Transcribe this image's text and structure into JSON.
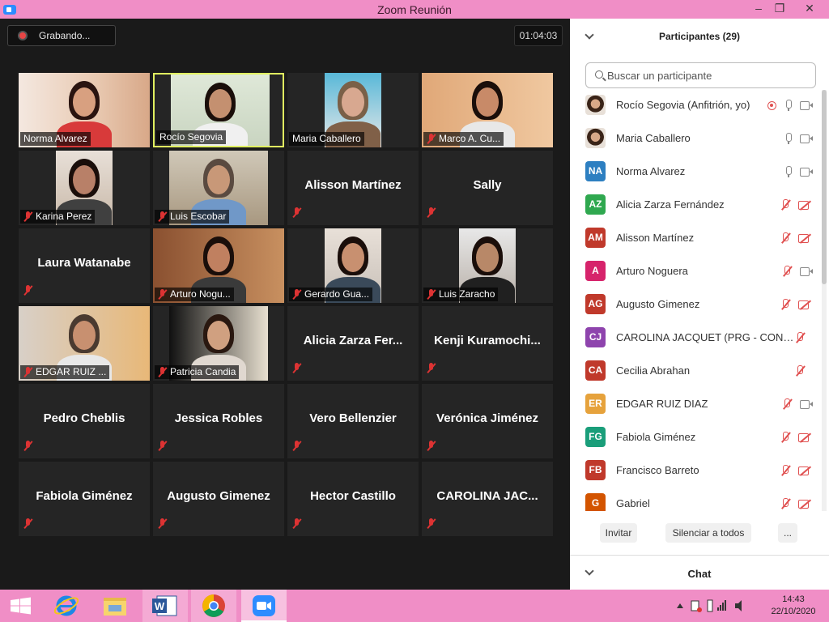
{
  "window": {
    "title": "Zoom Reunión"
  },
  "meeting": {
    "recording_label": "Grabando...",
    "timer": "01:04:03"
  },
  "tiles": [
    {
      "name": "Norma Alvarez",
      "video": true,
      "muted": false
    },
    {
      "name": "Rocío Segovia",
      "video": true,
      "muted": false
    },
    {
      "name": "Maria Caballero",
      "video": true,
      "muted": false
    },
    {
      "name": "Marco A. Cu...",
      "video": true,
      "muted": true
    },
    {
      "name": "Karina Perez",
      "video": true,
      "muted": true
    },
    {
      "name": "Luis Escobar",
      "video": true,
      "muted": true
    },
    {
      "name": "Alisson Martínez",
      "video": false,
      "muted": true
    },
    {
      "name": "Sally",
      "video": false,
      "muted": true
    },
    {
      "name": "Laura Watanabe",
      "video": false,
      "muted": true
    },
    {
      "name": "Arturo Nogu...",
      "video": true,
      "muted": true
    },
    {
      "name": "Gerardo Gua...",
      "video": true,
      "muted": true
    },
    {
      "name": "Luis Zaracho",
      "video": true,
      "muted": true
    },
    {
      "name": "EDGAR RUIZ ...",
      "video": true,
      "muted": true
    },
    {
      "name": "Patricia Candia",
      "video": true,
      "muted": true
    },
    {
      "name": "Alicia Zarza Fer...",
      "video": false,
      "muted": true
    },
    {
      "name": "Kenji Kuramochi...",
      "video": false,
      "muted": true
    },
    {
      "name": "Pedro Cheblis",
      "video": false,
      "muted": true
    },
    {
      "name": "Jessica Robles",
      "video": false,
      "muted": true
    },
    {
      "name": "Vero Bellenzier",
      "video": false,
      "muted": true
    },
    {
      "name": "Verónica Jiménez",
      "video": false,
      "muted": true
    },
    {
      "name": "Fabiola Giménez",
      "video": false,
      "muted": true
    },
    {
      "name": "Augusto Gimenez",
      "video": false,
      "muted": true
    },
    {
      "name": "Hector Castillo",
      "video": false,
      "muted": true
    },
    {
      "name": "CAROLINA JAC...",
      "video": false,
      "muted": true
    }
  ],
  "panel": {
    "title": "Participantes (29)",
    "search_placeholder": "Buscar un participante",
    "participants": [
      {
        "initials": "",
        "name": "Rocío Segovia (Anfitrión, yo)",
        "color": "#c9a0a0",
        "photo": true,
        "recording": true,
        "mic": "on",
        "cam": "on"
      },
      {
        "initials": "",
        "name": "Maria Caballero",
        "color": "#a08070",
        "photo": true,
        "recording": false,
        "mic": "on",
        "cam": "on"
      },
      {
        "initials": "NA",
        "name": "Norma Alvarez",
        "color": "#2d7fc1",
        "photo": false,
        "recording": false,
        "mic": "on",
        "cam": "on"
      },
      {
        "initials": "AZ",
        "name": "Alicia Zarza Fernández",
        "color": "#2fa84f",
        "photo": false,
        "recording": false,
        "mic": "off",
        "cam": "off"
      },
      {
        "initials": "AM",
        "name": "Alisson Martínez",
        "color": "#c0392b",
        "photo": false,
        "recording": false,
        "mic": "off",
        "cam": "off"
      },
      {
        "initials": "A",
        "name": "Arturo Noguera",
        "color": "#d6236b",
        "photo": false,
        "recording": false,
        "mic": "off",
        "cam": "on"
      },
      {
        "initials": "AG",
        "name": "Augusto Gimenez",
        "color": "#c0392b",
        "photo": false,
        "recording": false,
        "mic": "off",
        "cam": "off"
      },
      {
        "initials": "CJ",
        "name": "CAROLINA JACQUET (PRG - CONAT...",
        "color": "#8e44ad",
        "photo": false,
        "recording": false,
        "mic": "off",
        "cam": "none"
      },
      {
        "initials": "CA",
        "name": "Cecilia Abrahan",
        "color": "#c0392b",
        "photo": false,
        "recording": false,
        "mic": "off",
        "cam": "none"
      },
      {
        "initials": "ER",
        "name": "EDGAR RUIZ DIAZ",
        "color": "#e6a23c",
        "photo": false,
        "recording": false,
        "mic": "off",
        "cam": "on"
      },
      {
        "initials": "FG",
        "name": "Fabiola Giménez",
        "color": "#1a9e7a",
        "photo": false,
        "recording": false,
        "mic": "off",
        "cam": "off"
      },
      {
        "initials": "FB",
        "name": "Francisco Barreto",
        "color": "#c0392b",
        "photo": false,
        "recording": false,
        "mic": "off",
        "cam": "off"
      },
      {
        "initials": "G",
        "name": "Gabriel",
        "color": "#d35400",
        "photo": false,
        "recording": false,
        "mic": "off",
        "cam": "off"
      }
    ],
    "invite_label": "Invitar",
    "mute_all_label": "Silenciar a todos",
    "more_label": "...",
    "chat_title": "Chat"
  },
  "taskbar": {
    "apps": [
      "windows-start",
      "internet-explorer",
      "file-explorer",
      "microsoft-word",
      "google-chrome",
      "zoom"
    ],
    "time": "14:43",
    "date": "22/10/2020"
  }
}
